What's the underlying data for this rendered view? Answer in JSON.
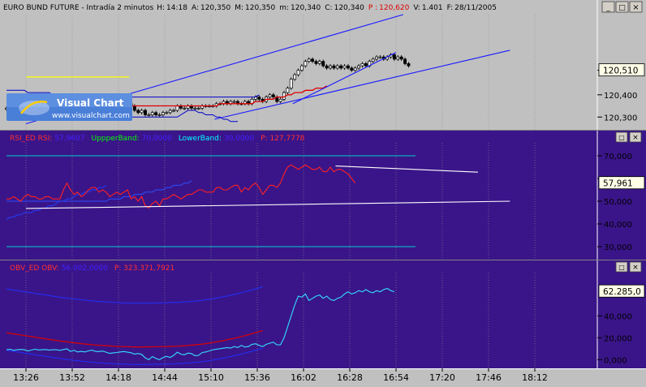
{
  "window": {
    "title_text": "EURO BUND FUTURE - Intradía 2 minutos",
    "quote": [
      {
        "label": "H:",
        "value": "14:18"
      },
      {
        "label": "A:",
        "value": "120,350"
      },
      {
        "label": "M:",
        "value": "120,350"
      },
      {
        "label": "m:",
        "value": "120,340"
      },
      {
        "label": "C:",
        "value": "120,340"
      },
      {
        "label": "P :",
        "value": "120,620"
      },
      {
        "label": "V:",
        "value": "1.401"
      },
      {
        "label": "F:",
        "value": "28/11/2005"
      }
    ],
    "buttons": [
      "_",
      "□",
      "×"
    ]
  },
  "logo": {
    "name": "Visual Chart",
    "url": "www.visualchart.com"
  },
  "colors": {
    "price_bg": "#c0c0c0",
    "indicator_bg": "#3a1589",
    "grid": "#8a8a8a",
    "candle": "#000000",
    "band": "#0000cc",
    "ma": "#dd0000",
    "rsi": "#ff2020",
    "obv": "#33ddff",
    "trend": "#1a1aff",
    "cyan_line": "#00d0d0",
    "white_line": "#ffffff",
    "yellow_line": "#ffff00"
  },
  "chart_data": [
    {
      "type": "candlestick",
      "title": "EURO BUND FUTURE - Intradía 2 minutos",
      "ylim": [
        120.25,
        120.76
      ],
      "y_ticks": [
        "120,300",
        "120,400",
        "120,510"
      ],
      "y_tick_values": [
        120.3,
        120.4,
        120.51
      ],
      "last_value_label": "120,510",
      "last_value": 120.51,
      "close": [
        120.34,
        120.33,
        120.33,
        120.34,
        120.33,
        120.34,
        120.35,
        120.34,
        120.34,
        120.33,
        120.33,
        120.34,
        120.34,
        120.34,
        120.34,
        120.34,
        120.36,
        120.37,
        120.37,
        120.36,
        120.36,
        120.36,
        120.37,
        120.37,
        120.37,
        120.36,
        120.35,
        120.34,
        120.34,
        120.35,
        120.36,
        120.35,
        120.36,
        120.36,
        120.36,
        120.35,
        120.33,
        120.32,
        120.33,
        120.31,
        120.31,
        120.32,
        120.31,
        120.31,
        120.32,
        120.32,
        120.33,
        120.33,
        120.35,
        120.34,
        120.34,
        120.35,
        120.34,
        120.34,
        120.34,
        120.35,
        120.35,
        120.35,
        120.35,
        120.36,
        120.36,
        120.37,
        120.36,
        120.37,
        120.37,
        120.36,
        120.36,
        120.37,
        120.36,
        120.38,
        120.39,
        120.38,
        120.37,
        120.39,
        120.4,
        120.39,
        120.37,
        120.38,
        120.41,
        120.43,
        120.47,
        120.49,
        120.51,
        120.53,
        120.55,
        120.56,
        120.55,
        120.54,
        120.55,
        120.53,
        120.52,
        120.53,
        120.52,
        120.53,
        120.52,
        120.53,
        120.52,
        120.51,
        120.52,
        120.53,
        120.54,
        120.53,
        120.55,
        120.56,
        120.57,
        120.57,
        120.56,
        120.57,
        120.58,
        120.56,
        120.57,
        120.56,
        120.54,
        120.53
      ],
      "upper_band": [
        120.42,
        120.42,
        120.42,
        120.42,
        120.42,
        120.42,
        120.41,
        120.41,
        120.41,
        120.41,
        120.41,
        120.41,
        120.41,
        120.4,
        120.4,
        120.4,
        120.4,
        120.39,
        120.39,
        120.39,
        120.39,
        120.39,
        120.39,
        120.39,
        120.39,
        120.39,
        120.39,
        120.39,
        120.39,
        120.39,
        120.39,
        120.39,
        120.39,
        120.39,
        120.39,
        120.39,
        120.39,
        120.39,
        120.39,
        120.39,
        120.39,
        120.39,
        120.39,
        120.39,
        120.39,
        120.39,
        120.39,
        120.39,
        120.39,
        120.39,
        120.39,
        120.39,
        120.39,
        120.39,
        120.39,
        120.39,
        120.39,
        120.39,
        120.39,
        120.39,
        120.39,
        120.39,
        120.39,
        120.39,
        120.39,
        120.39,
        120.39,
        120.39,
        120.39,
        120.39,
        120.39,
        120.4
      ],
      "middle_ma": [
        120.37,
        120.37,
        120.36,
        120.36,
        120.36,
        120.36,
        120.36,
        120.36,
        120.36,
        120.35,
        120.35,
        120.35,
        120.35,
        120.35,
        120.35,
        120.35,
        120.35,
        120.35,
        120.35,
        120.35,
        120.35,
        120.35,
        120.35,
        120.35,
        120.35,
        120.35,
        120.35,
        120.35,
        120.35,
        120.35,
        120.35,
        120.35,
        120.35,
        120.35,
        120.35,
        120.35,
        120.35,
        120.35,
        120.35,
        120.35,
        120.35,
        120.35,
        120.35,
        120.35,
        120.35,
        120.35,
        120.35,
        120.35,
        120.35,
        120.35,
        120.35,
        120.35,
        120.35,
        120.35,
        120.35,
        120.35,
        120.35,
        120.35,
        120.35,
        120.35,
        120.36,
        120.36,
        120.36,
        120.36,
        120.36,
        120.36,
        120.36,
        120.36,
        120.36,
        120.36,
        120.37,
        120.37,
        120.37,
        120.38,
        120.38,
        120.38,
        120.39,
        120.39,
        120.39,
        120.4,
        120.4,
        120.41,
        120.41,
        120.41,
        120.42,
        120.42,
        120.42,
        120.43,
        120.43,
        120.43,
        120.44
      ],
      "lower_band": [
        120.3,
        120.3,
        120.3,
        120.3,
        120.3,
        120.3,
        120.3,
        120.3,
        120.3,
        120.3,
        120.3,
        120.3,
        120.3,
        120.3,
        120.3,
        120.3,
        120.3,
        120.3,
        120.3,
        120.3,
        120.3,
        120.3,
        120.3,
        120.3,
        120.3,
        120.3,
        120.3,
        120.3,
        120.3,
        120.3,
        120.3,
        120.3,
        120.3,
        120.3,
        120.3,
        120.3,
        120.3,
        120.3,
        120.3,
        120.3,
        120.3,
        120.3,
        120.3,
        120.3,
        120.3,
        120.3,
        120.3,
        120.3,
        120.3,
        120.31,
        120.32,
        120.33,
        120.33,
        120.33,
        120.32,
        120.32,
        120.31,
        120.31,
        120.31,
        120.3,
        120.3,
        120.29,
        120.29,
        120.28,
        120.28,
        120.28
      ],
      "trend_lines": [
        {
          "from": [
            "13:26",
            120.27
          ],
          "to": [
            "16:58",
            120.76
          ]
        },
        {
          "from": [
            "15:12",
            120.29
          ],
          "to": [
            "17:58",
            120.6
          ]
        },
        {
          "from": [
            "15:56",
            120.36
          ],
          "to": [
            "16:54",
            120.59
          ]
        }
      ],
      "hline": {
        "value": 120.48,
        "x_from": "13:26",
        "x_to": "14:24"
      }
    },
    {
      "type": "line",
      "title_parts": [
        {
          "text": "RSI_ED  RSI:",
          "color": "#ff3030"
        },
        {
          "text": "57,9607",
          "color": "#4420ff"
        },
        {
          "text": "UppperBand:",
          "color": "#00ff00"
        },
        {
          "text": "70,0000",
          "color": "#4420ff"
        },
        {
          "text": "LowerBand:",
          "color": "#00ffff"
        },
        {
          "text": "30,0000",
          "color": "#4420ff"
        },
        {
          "text": "P: 127,7778",
          "color": "#ff3030"
        }
      ],
      "ylim": [
        25,
        75
      ],
      "y_ticks": [
        "30,000",
        "40,000",
        "50,000",
        "60,000",
        "70,000"
      ],
      "y_tick_values": [
        30,
        40,
        50,
        60,
        70
      ],
      "last_value_label": "57,961",
      "last_value": 57.961,
      "upper_band": 70,
      "lower_band": 30,
      "series": [
        {
          "values": [
            51,
            51,
            52,
            51,
            50,
            52,
            53,
            52,
            52,
            51,
            51,
            52,
            52,
            51,
            51,
            51,
            55,
            58,
            55,
            53,
            54,
            52,
            53,
            55,
            56,
            56,
            54,
            55,
            54,
            52,
            53,
            54,
            53,
            54,
            55,
            51,
            52,
            50,
            52,
            48,
            47,
            49,
            50,
            48,
            51,
            51,
            52,
            53,
            52,
            51,
            52,
            53,
            53,
            54,
            55,
            55,
            54,
            54,
            54,
            56,
            56,
            55,
            55,
            56,
            57,
            57,
            54,
            56,
            55,
            57,
            58,
            56,
            53,
            55,
            57,
            57,
            56,
            58,
            62,
            65,
            66,
            65,
            64,
            65,
            66,
            65,
            64,
            64,
            65,
            63,
            63,
            65,
            63,
            64,
            64,
            63,
            62,
            60,
            58
          ]
        },
        {
          "values": [
            50,
            51,
            51,
            52,
            52,
            53,
            53,
            53,
            54,
            54,
            55,
            55,
            56,
            56,
            57,
            58,
            58,
            59,
            59,
            60,
            61,
            61,
            62,
            62,
            63,
            63,
            64,
            64,
            65
          ]
        },
        {
          "values": [
            50,
            50,
            50,
            50,
            50,
            50,
            50,
            50,
            50,
            50,
            50,
            50,
            50,
            50,
            50,
            50,
            50,
            50,
            50,
            50,
            50,
            50,
            50,
            50,
            50,
            50,
            50,
            50,
            50,
            51,
            51,
            51,
            51,
            52,
            52,
            52,
            53,
            53,
            53,
            54,
            54,
            54,
            55,
            55,
            55,
            56,
            56,
            57,
            57,
            57,
            58,
            58,
            59
          ]
        }
      ],
      "trend_lines": [
        {
          "from": [
            "13:26",
            46.8
          ],
          "to": [
            "17:58",
            50.0
          ]
        },
        {
          "from": [
            "16:20",
            65.5
          ],
          "to": [
            "17:40",
            62.8
          ]
        }
      ]
    },
    {
      "type": "line",
      "title_parts": [
        {
          "text": "OBV_ED  OBV:",
          "color": "#ff3030"
        },
        {
          "text": "56.002,0000",
          "color": "#4420ff"
        },
        {
          "text": "P: 323.371,7921",
          "color": "#ff3030"
        }
      ],
      "ylim": [
        -5000,
        78000
      ],
      "y_ticks": [
        "0,000",
        "20,000",
        "40,000"
      ],
      "y_tick_values": [
        0,
        20000,
        40000
      ],
      "last_value_label": "62.285,0",
      "last_value": 62285,
      "series": [
        {
          "values": [
            9000,
            9500,
            8500,
            9000,
            9300,
            9000,
            8000,
            8700,
            9500,
            8800,
            9000,
            9200,
            8600,
            9000,
            9000,
            8500,
            9200,
            9800,
            7500,
            8500,
            7000,
            7500,
            7000,
            8000,
            8600,
            7500,
            7300,
            7800,
            6800,
            5700,
            6200,
            6500,
            7000,
            7400,
            6800,
            6300,
            5000,
            5600,
            4800,
            1500,
            0,
            2800,
            1000,
            0,
            2000,
            3000,
            2000,
            4000,
            6800,
            5000,
            4400,
            6000,
            5500,
            3500,
            4000,
            6500,
            7000,
            8000,
            9000,
            9500,
            10000,
            10500,
            11000,
            10500,
            12000,
            11000,
            13000,
            11500,
            12000,
            14000,
            14500,
            13000,
            12000,
            14000,
            15000,
            16000,
            13500,
            13500,
            20000,
            30000,
            40000,
            50000,
            58000,
            57000,
            60000,
            54000,
            56000,
            58000,
            59000,
            56000,
            58000,
            55000,
            54000,
            56000,
            57000,
            60000,
            62000,
            60000,
            61000,
            63000,
            62000,
            64000,
            62000,
            61000,
            63000,
            62000,
            64000,
            65000,
            63000,
            62000
          ]
        },
        {
          "values": [
            24500,
            24000,
            23500,
            23000,
            22600,
            22000,
            21500,
            21000,
            20500,
            20000,
            19500,
            19000,
            18500,
            18000,
            17500,
            17000,
            16600,
            16200,
            15800,
            15400,
            15000,
            14600,
            14300,
            14000,
            13700,
            13400,
            13100,
            12900,
            12700,
            12500,
            12300,
            12100,
            12000,
            11900,
            11800,
            11700,
            11600,
            11600,
            11600,
            11600,
            11700,
            11700,
            11800,
            11800,
            11900,
            12000,
            12100,
            12200,
            12300,
            12500,
            12700,
            12900,
            13200,
            13500,
            13800,
            14200,
            14600,
            15100,
            15600,
            16200,
            16800,
            17400,
            18100,
            18800,
            19500,
            20300,
            21100,
            21900,
            22800,
            23700,
            24600,
            25500,
            26500
          ]
        }
      ]
    }
  ],
  "time_axis": {
    "labels": [
      "13:26",
      "13:52",
      "14:18",
      "14:44",
      "15:10",
      "15:36",
      "16:02",
      "16:28",
      "16:54",
      "17:20",
      "17:46",
      "18:12"
    ]
  }
}
